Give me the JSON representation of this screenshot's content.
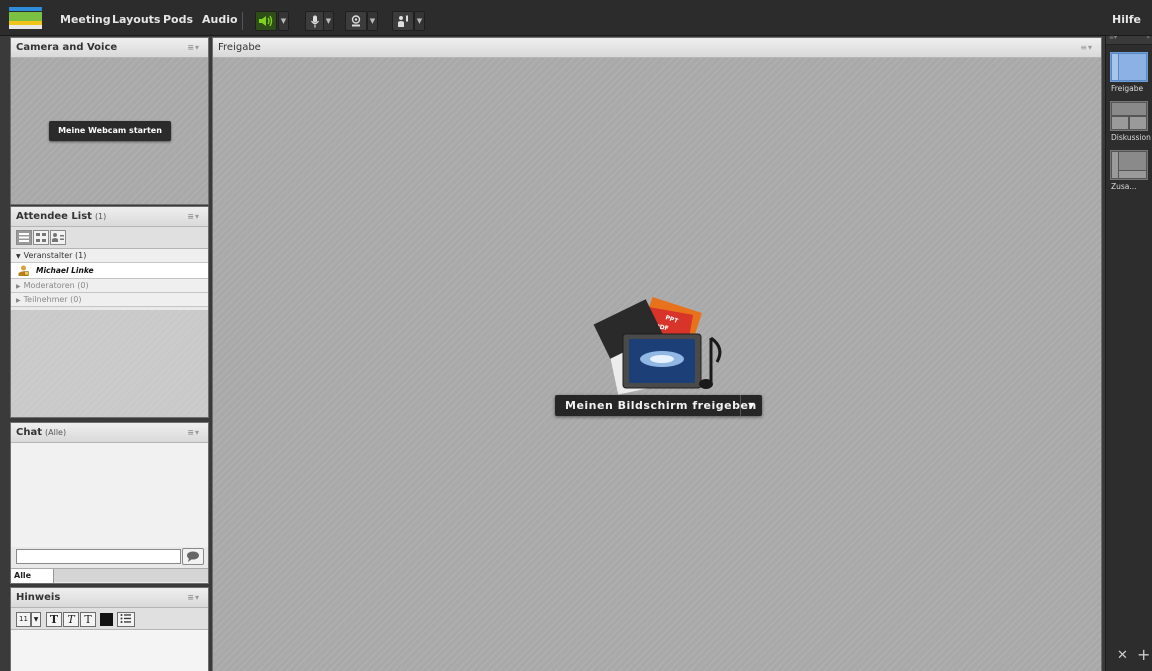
{
  "menubar": {
    "items": [
      "Meeting",
      "Layouts",
      "Pods",
      "Audio"
    ],
    "help": "Hilfe"
  },
  "pods": {
    "camera": {
      "title": "Camera and Voice",
      "start_webcam": "Meine Webcam starten"
    },
    "attendees": {
      "title": "Attendee List",
      "count": "(1)",
      "groups": {
        "hosts": "Veranstalter (1)",
        "moderators": "Moderatoren (0)",
        "participants": "Teilnehmer (0)"
      },
      "host_user": "Michael Linke"
    },
    "chat": {
      "title": "Chat",
      "scope": "(Alle)",
      "tab_all": "Alle"
    },
    "hint": {
      "title": "Hinweis",
      "font_size": "11"
    },
    "share": {
      "title": "Freigabe",
      "share_screen": "Meinen Bildschirm freigeben"
    }
  },
  "layouts": {
    "items": [
      "Freigabe",
      "Diskussion",
      "Zusa..."
    ]
  },
  "colors": {
    "audio_active": "#7ed321",
    "layout_selected": "#5b87c4",
    "menubar_bg": "#2c2c2c"
  }
}
